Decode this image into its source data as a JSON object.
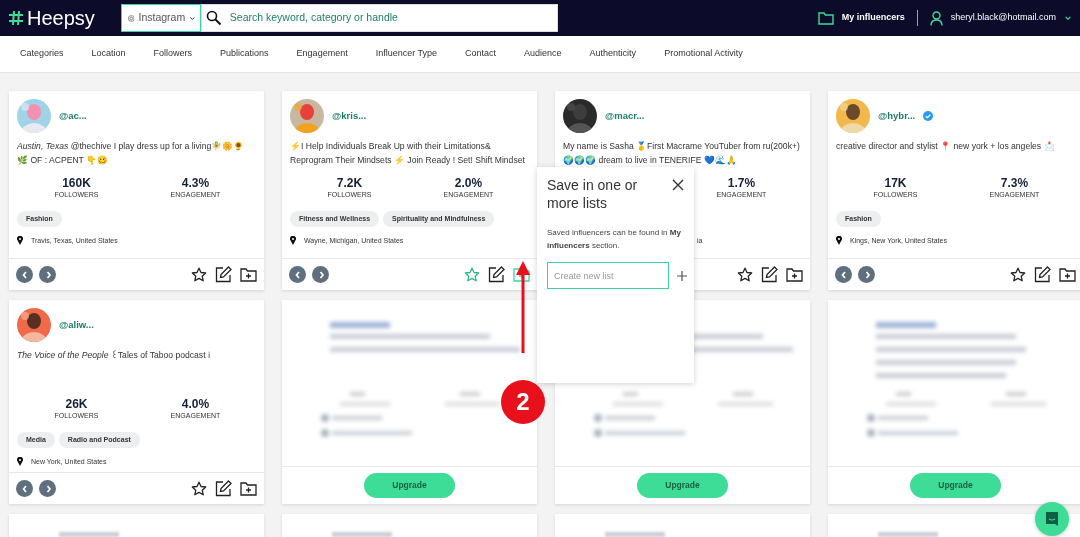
{
  "header": {
    "logo": "Heepsy",
    "platform": "Instagram",
    "search_placeholder": "Search keyword, category or handle",
    "my_influencers": "My influencers",
    "user_email": "sheryl.black@hotmail.com"
  },
  "filters": [
    "Categories",
    "Location",
    "Followers",
    "Publications",
    "Engagement",
    "Influencer Type",
    "Contact",
    "Audience",
    "Authenticity",
    "Promotional Activity"
  ],
  "cards": [
    {
      "kind": "profile",
      "handle": "@ac...",
      "verified": false,
      "covered": false,
      "bio": "*Austin, Texas* @thechive I play dress up for a living🧚🌼🌻🌿 OF : ACPENT 👇🥴",
      "followers": "160K",
      "followers_label": "FOLLOWERS",
      "engagement": "4.3%",
      "engagement_label": "ENGAGEMENT",
      "tags": [
        "Fashion"
      ],
      "location": "Travis, Texas, United States",
      "favorite": false,
      "list_open": false
    },
    {
      "kind": "profile",
      "handle": "@kris...",
      "verified": false,
      "covered": false,
      "bio": "⚡I Help Individuals Break Up with their Limitations& Reprogram Their Mindsets ⚡ Join Ready ! Set! Shift Mindset",
      "followers": "7.2K",
      "followers_label": "FOLLOWERS",
      "engagement": "2.0%",
      "engagement_label": "ENGAGEMENT",
      "tags": [
        "Fitness and Wellness",
        "Spirituality and Mindfulness"
      ],
      "location": "Wayne, Michigan, United States",
      "favorite": true,
      "list_open": true
    },
    {
      "kind": "profile",
      "handle": "@macr...",
      "verified": false,
      "covered": true,
      "bio": "My name is Sasha 🥇First Macrame YouTuber from ru(200k+) 🌍🌍🌍 dream to live in TENERIFE 💙🌊🙏",
      "engagement": "1.7%",
      "engagement_label": "ENGAGEMENT",
      "location": "ia",
      "favorite": false,
      "list_open": false
    },
    {
      "kind": "profile",
      "handle": "@hybr...",
      "verified": true,
      "covered": false,
      "bio": "creative director and stylist 📍 new york + los angeles 📩",
      "followers": "17K",
      "followers_label": "FOLLOWERS",
      "engagement": "7.3%",
      "engagement_label": "ENGAGEMENT",
      "tags": [
        "Fashion"
      ],
      "location": "Kings, New York, United States",
      "favorite": false,
      "list_open": false
    },
    {
      "kind": "profile",
      "handle": "@aliw...",
      "verified": false,
      "covered": false,
      "bio": "*The Voice of the People* ꒰Tales of Taboo podcast ℹ",
      "followers": "26K",
      "followers_label": "FOLLOWERS",
      "engagement": "4.0%",
      "engagement_label": "ENGAGEMENT",
      "tags": [
        "Media",
        "Radio and Podcast"
      ],
      "location": "New York, United States",
      "favorite": false,
      "list_open": false
    },
    {
      "kind": "locked",
      "button": "Upgrade"
    },
    {
      "kind": "locked",
      "button": "Upgrade"
    },
    {
      "kind": "locked",
      "button": "Upgrade"
    },
    {
      "kind": "cut"
    },
    {
      "kind": "cut"
    },
    {
      "kind": "cut"
    },
    {
      "kind": "cut"
    }
  ],
  "save_popup": {
    "title": "Save in one or more lists",
    "text": "Saved influencers can be found in **My influencers** section.",
    "input_placeholder": "Create new list"
  },
  "annotation": {
    "step": "2"
  }
}
